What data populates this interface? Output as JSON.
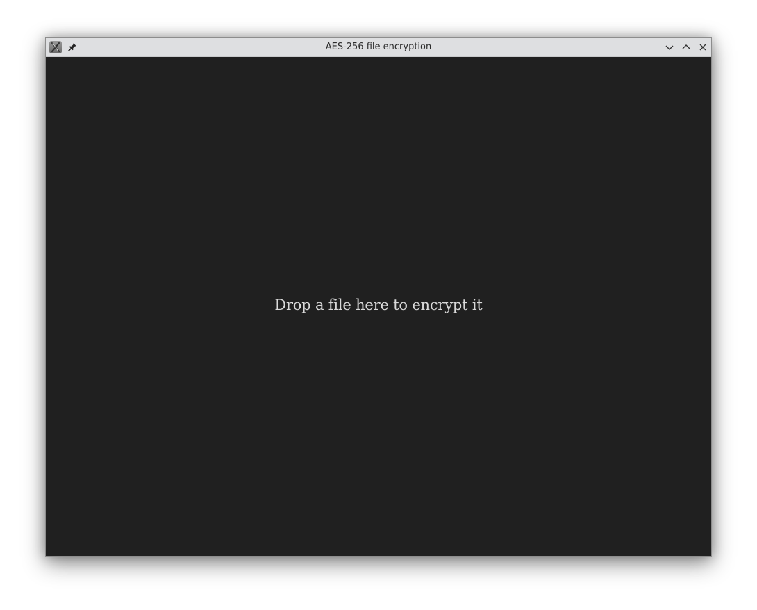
{
  "window": {
    "title": "AES-256 file encryption"
  },
  "titlebar": {
    "icons": {
      "app": "x-app-icon",
      "pin": "pin-icon",
      "minimize": "chevron-down-icon",
      "maximize": "chevron-up-icon",
      "close": "close-icon"
    }
  },
  "content": {
    "drop_hint": "Drop a file here to encrypt it"
  },
  "colors": {
    "titlebar_bg": "#dedfe1",
    "content_bg": "#202020",
    "text": "#d9d9d9"
  }
}
